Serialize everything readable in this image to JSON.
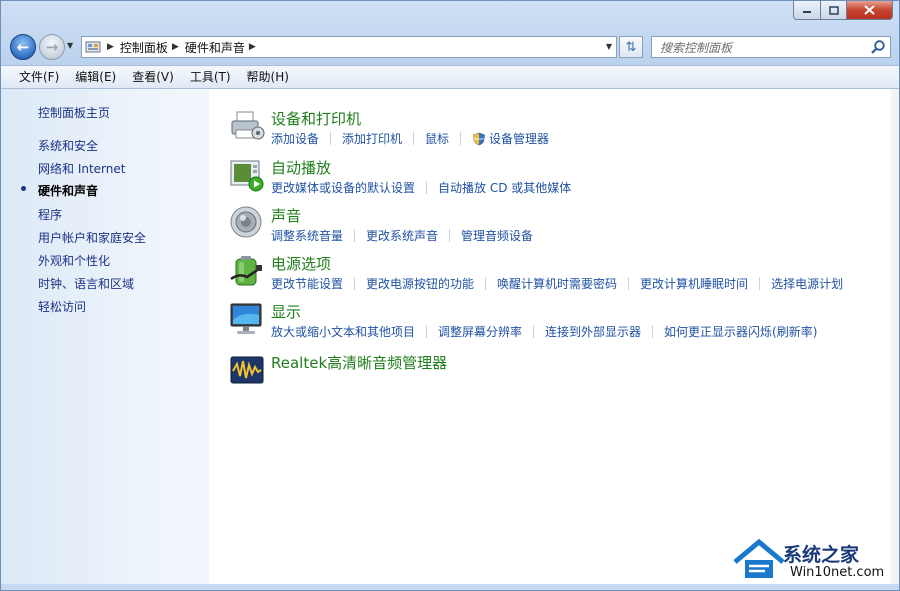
{
  "address_bar": {
    "crumbs": [
      "控制面板",
      "硬件和声音"
    ]
  },
  "search": {
    "placeholder": "搜索控制面板"
  },
  "menu": [
    "文件(F)",
    "编辑(E)",
    "查看(V)",
    "工具(T)",
    "帮助(H)"
  ],
  "sidebar": {
    "home": "控制面板主页",
    "items": [
      {
        "label": "系统和安全",
        "current": false
      },
      {
        "label": "网络和 Internet",
        "current": false
      },
      {
        "label": "硬件和声音",
        "current": true
      },
      {
        "label": "程序",
        "current": false
      },
      {
        "label": "用户帐户和家庭安全",
        "current": false
      },
      {
        "label": "外观和个性化",
        "current": false
      },
      {
        "label": "时钟、语言和区域",
        "current": false
      },
      {
        "label": "轻松访问",
        "current": false
      }
    ]
  },
  "categories": [
    {
      "title": "设备和打印机",
      "icon": "printer-icon",
      "links": [
        "添加设备",
        "添加打印机",
        "鼠标",
        "设备管理器"
      ]
    },
    {
      "title": "自动播放",
      "icon": "autoplay-icon",
      "links": [
        "更改媒体或设备的默认设置",
        "自动播放 CD 或其他媒体"
      ]
    },
    {
      "title": "声音",
      "icon": "speaker-icon",
      "links": [
        "调整系统音量",
        "更改系统声音",
        "管理音频设备"
      ]
    },
    {
      "title": "电源选项",
      "icon": "battery-icon",
      "links": [
        "更改节能设置",
        "更改电源按钮的功能",
        "唤醒计算机时需要密码",
        "更改计算机睡眠时间",
        "选择电源计划"
      ]
    },
    {
      "title": "显示",
      "icon": "monitor-icon",
      "links": [
        "放大或缩小文本和其他项目",
        "调整屏幕分辨率",
        "连接到外部显示器",
        "如何更正显示器闪烁(刷新率)"
      ]
    },
    {
      "title": "Realtek高清晰音频管理器",
      "icon": "realtek-audio-icon",
      "links": []
    }
  ],
  "watermark": {
    "line1": "系统之家",
    "line2": "Win10net.com"
  },
  "colors": {
    "category_title": "#217e1c",
    "link": "#2052a4",
    "sidebar_link": "#1e3287"
  }
}
